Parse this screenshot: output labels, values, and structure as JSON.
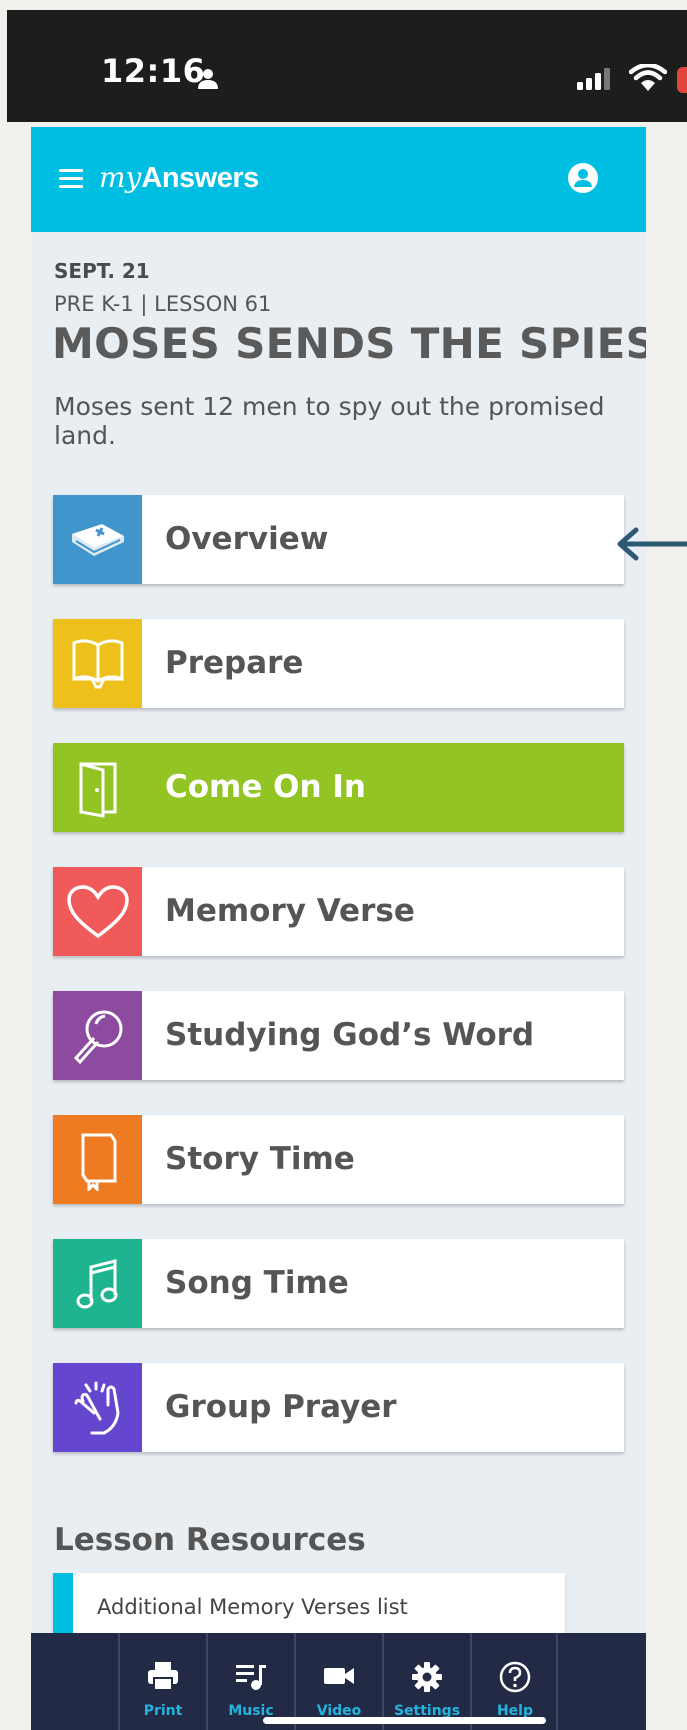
{
  "status_bar": {
    "time": "12:16"
  },
  "app": {
    "brand_my": "my",
    "brand_answers": "Answers"
  },
  "lesson": {
    "date": "SEPT. 21",
    "grade": "PRE K-1 | LESSON 61",
    "title": "MOSES SENDS THE SPIES",
    "summary": "Moses sent 12 men to spy out the promised land."
  },
  "menu": [
    {
      "label": "Overview",
      "icon": "bible-icon",
      "color": "#4095cc"
    },
    {
      "label": "Prepare",
      "icon": "open-book-icon",
      "color": "#eec01c"
    },
    {
      "label": "Come On In",
      "icon": "door-icon",
      "color": "#92c424",
      "active": true
    },
    {
      "label": "Memory Verse",
      "icon": "heart-icon",
      "color": "#f15a5a"
    },
    {
      "label": "Studying God’s Word",
      "icon": "magnifier-icon",
      "color": "#8c4b9e"
    },
    {
      "label": "Story Time",
      "icon": "storybook-icon",
      "color": "#ee7a22"
    },
    {
      "label": "Song Time",
      "icon": "music-note-icon",
      "color": "#1fb490"
    },
    {
      "label": "Group Prayer",
      "icon": "praying-hands-icon",
      "color": "#6546cf"
    }
  ],
  "resources": {
    "title": "Lesson Resources",
    "items": [
      "Additional Memory Verses list"
    ]
  },
  "bottom_nav": [
    "Print",
    "Music",
    "Video",
    "Settings",
    "Help"
  ],
  "colors": {
    "header": "#00bde2",
    "nav_bg": "#232a45",
    "nav_accent": "#23b4dd",
    "arrow": "#2c5a72"
  }
}
